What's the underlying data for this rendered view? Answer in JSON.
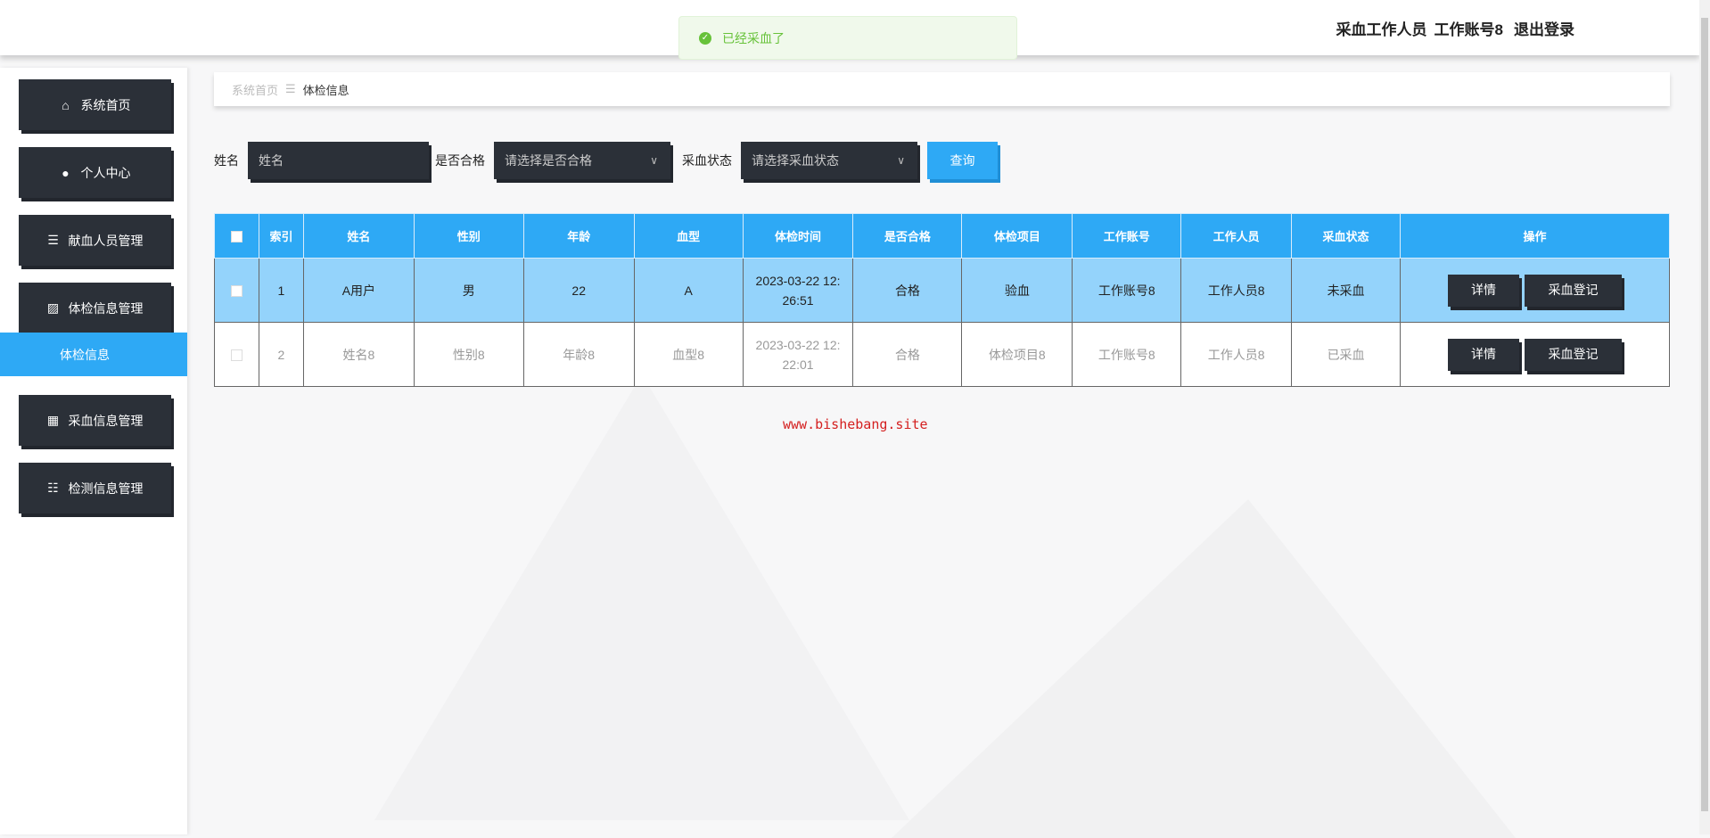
{
  "header": {
    "role": "采血工作人员",
    "account": "工作账号8",
    "logout": "退出登录"
  },
  "toast": {
    "message": "已经采血了",
    "icon": "check-circle-icon",
    "color": "#67c23a"
  },
  "sidebar": {
    "items": [
      {
        "label": "系统首页",
        "icon": "home-icon"
      },
      {
        "label": "个人中心",
        "icon": "user-icon"
      },
      {
        "label": "献血人员管理",
        "icon": "list-icon"
      },
      {
        "label": "体检信息管理",
        "icon": "chart-icon"
      },
      {
        "label": "采血信息管理",
        "icon": "grid-icon"
      },
      {
        "label": "检测信息管理",
        "icon": "sliders-icon"
      }
    ],
    "active_sub": "体检信息"
  },
  "breadcrumb": {
    "home": "系统首页",
    "current": "体检信息"
  },
  "search": {
    "name_label": "姓名",
    "name_placeholder": "姓名",
    "qualified_label": "是否合格",
    "qualified_placeholder": "请选择是否合格",
    "status_label": "采血状态",
    "status_placeholder": "请选择采血状态",
    "query": "查询"
  },
  "table": {
    "headers": [
      "索引",
      "姓名",
      "性别",
      "年龄",
      "血型",
      "体检时间",
      "是否合格",
      "体检项目",
      "工作账号",
      "工作人员",
      "采血状态",
      "操作"
    ],
    "rows": [
      {
        "index": "1",
        "name": "A用户",
        "gender": "男",
        "age": "22",
        "blood": "A",
        "time1": "2023-03-22 12:",
        "time2": "26:51",
        "qualified": "合格",
        "item": "验血",
        "account": "工作账号8",
        "staff": "工作人员8",
        "status": "未采血"
      },
      {
        "index": "2",
        "name": "姓名8",
        "gender": "性别8",
        "age": "年龄8",
        "blood": "血型8",
        "time1": "2023-03-22 12:",
        "time2": "22:01",
        "qualified": "合格",
        "item": "体检项目8",
        "account": "工作账号8",
        "staff": "工作人员8",
        "status": "已采血"
      }
    ],
    "detail": "详情",
    "register": "采血登记"
  },
  "watermark": "www.bishebang.site",
  "colors": {
    "accent": "#2ea9f5",
    "dark": "#2b3038",
    "row_highlight": "#94d3fb"
  }
}
